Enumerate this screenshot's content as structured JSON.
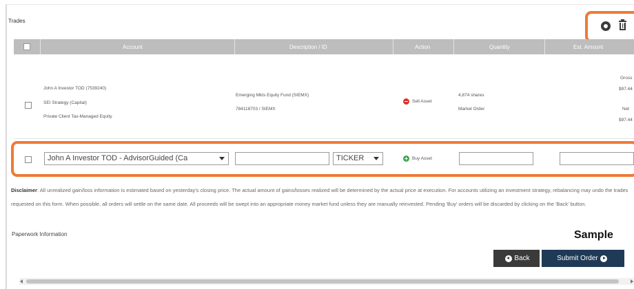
{
  "section": {
    "title": "Trades"
  },
  "toolbar": {
    "settings_icon": "gear-icon",
    "delete_icon": "trash-icon"
  },
  "table": {
    "headers": [
      "Account",
      "Description / ID",
      "Action",
      "Quantity",
      "Est. Amount"
    ],
    "existing_row": {
      "account_lines": [
        "John A Investor TOD (7539240)",
        "SEI Strategy (Capital)",
        "Private Client Tax-Managed Equity"
      ],
      "description_lines": [
        "Emerging Mkts Equity Fund (SIEMX)",
        "784118703 / SIEMX"
      ],
      "action": "Sell Asset",
      "quantity_lines": [
        "4,874 shares",
        "Market Order"
      ],
      "amount_lines": [
        "Gross",
        "$97.44",
        "Net",
        "$97.44"
      ]
    },
    "new_row": {
      "account_selected": "John A Investor TOD - AdvisorGuided (Ca",
      "description_value": "",
      "ticker_selected": "TICKER",
      "action": "Buy Asset",
      "quantity_value": "",
      "amount_value": ""
    }
  },
  "disclaimer": {
    "label": "Disclaimer",
    "text": ": All unrealized gain/loss information is estimated based on yesterday's closing price. The actual amount of gains/losses realized will be determined by the actual price at execution. For accounts utilizing an investment strategy, rebalancing may undo the trades requested on this form. When possible, all orders will settle on the same date. All proceeds will be swept into an appropriate money market fund unless they are manually reinvested. Pending 'Buy' orders will be discarded by clicking on the 'Back' button."
  },
  "paperwork": {
    "label": "Paperwork Information"
  },
  "sample_label": "Sample",
  "buttons": {
    "back": "Back",
    "submit": "Submit Order"
  },
  "colors": {
    "highlight": "#ef7a36",
    "header_bg": "#bdbdbd",
    "submit_bg": "#1f3a56",
    "back_bg": "#3a3a3a",
    "sell": "#d9332b",
    "buy": "#3aa34a"
  }
}
